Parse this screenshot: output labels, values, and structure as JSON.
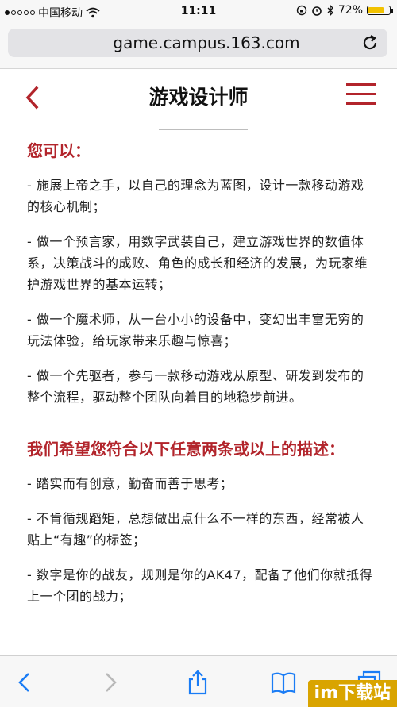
{
  "status_bar": {
    "carrier": "中国移动",
    "time": "11:11",
    "battery": "72%",
    "battery_level": 0.72
  },
  "browser": {
    "url": "game.campus.163.com"
  },
  "page": {
    "title": "游戏设计师"
  },
  "sections": [
    {
      "title": "您可以：",
      "items": [
        "- 施展上帝之手，以自己的理念为蓝图，设计一款移动游戏的核心机制；",
        "- 做一个预言家，用数字武装自己，建立游戏世界的数值体系，决策战斗的成败、角色的成长和经济的发展，为玩家维护游戏世界的基本运转；",
        "- 做一个魔术师，从一台小小的设备中，变幻出丰富无穷的玩法体验，给玩家带来乐趣与惊喜；",
        "- 做一个先驱者，参与一款移动游戏从原型、研发到发布的整个流程，驱动整个团队向着目的地稳步前进。"
      ]
    },
    {
      "title": "我们希望您符合以下任意两条或以上的描述：",
      "items": [
        "- 踏实而有创意，勤奋而善于思考；",
        "- 不肯循规蹈矩，总想做出点什么不一样的东西，经常被人贴上“有趣”的标签；",
        "- 数字是你的战友，规则是你的AK47，配备了他们你就抵得上一个团的战力；"
      ]
    }
  ],
  "watermark": "im下载站",
  "colors": {
    "accent": "#b2242b",
    "watermark_bg": "#d9a400"
  }
}
